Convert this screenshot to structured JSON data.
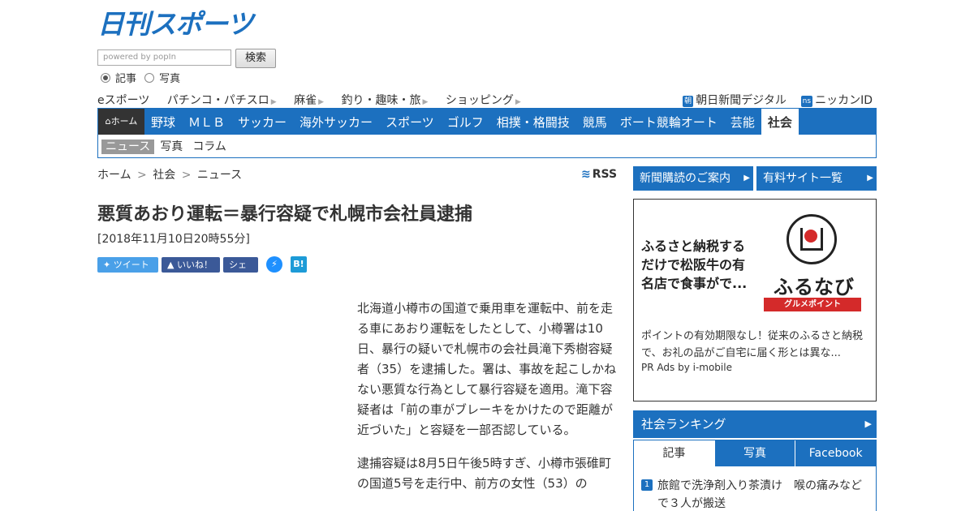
{
  "header": {
    "logo_text": "日刊スポーツ",
    "search_placeholder": "powered by popIn",
    "search_button": "検索",
    "radio_article": "記事",
    "radio_photo": "写真"
  },
  "subnav": {
    "items": [
      "eスポーツ",
      "パチンコ・パチスロ",
      "麻雀",
      "釣り・趣味・旅",
      "ショッピング"
    ],
    "asahi_badge": "朝",
    "asahi": "朝日新聞デジタル",
    "ns_badge": "ns",
    "nikkan_id": "ニッカンID"
  },
  "mainnav": {
    "home": "ホーム",
    "items": [
      "野球",
      "ＭＬＢ",
      "サッカー",
      "海外サッカー",
      "スポーツ",
      "ゴルフ",
      "相撲・格闘技",
      "競馬",
      "ボート競輪オート",
      "芸能",
      "社会"
    ],
    "sub": [
      "ニュース",
      "写真",
      "コラム"
    ]
  },
  "breadcrumb": {
    "home": "ホーム",
    "section": "社会",
    "current": "ニュース",
    "sep": ">"
  },
  "rss": "RSS",
  "article": {
    "title": "悪質あおり運転＝暴行容疑で札幌市会社員逮捕",
    "date": "[2018年11月10日20時55分]",
    "p1": "北海道小樽市の国道で乗用車を運転中、前を走る車にあおり運転をしたとして、小樽署は10日、暴行の疑いで札幌市の会社員滝下秀樹容疑者（35）を逮捕した。署は、事故を起こしかねない悪質な行為として暴行容疑を適用。滝下容疑者は「前の車がブレーキをかけたので距離が近づいた」と容疑を一部否認している。",
    "p2": "逮捕容疑は8月5日午後5時すぎ、小樽市張碓町の国道5号を走行中、前方の女性（53）の"
  },
  "share": {
    "tweet": "ツイート",
    "like": "いいね！",
    "fb_share": "シェア",
    "hatena": "B!"
  },
  "sidebar": {
    "subscribe": "新聞購読のご案内",
    "paid_sites": "有料サイト一覧",
    "ad": {
      "headline": "ふるさと納税するだけで松阪牛の有名店で食事がで...",
      "brand": "ふるなび",
      "brand_sub": "グルメポイント",
      "desc": "ポイントの有効期限なし！従来のふるさと納税で、お礼の品がご自宅に届く形とは異な...",
      "pr": "PR  Ads by i-mobile"
    },
    "ranking_title": "社会ランキング",
    "tabs": [
      "記事",
      "写真",
      "Facebook"
    ],
    "rank1_num": "1",
    "rank1_text": "旅館で洗浄剤入り茶漬け　喉の痛みなどで３人が搬送"
  }
}
